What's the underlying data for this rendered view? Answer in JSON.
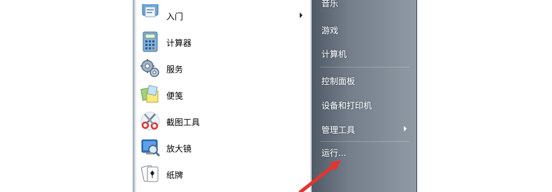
{
  "programs": [
    {
      "label": "入门"
    },
    {
      "label": "计算器"
    },
    {
      "label": "服务"
    },
    {
      "label": "便笺"
    },
    {
      "label": "截图工具"
    },
    {
      "label": "放大镜"
    },
    {
      "label": "纸牌"
    }
  ],
  "right_menu": {
    "music": "音乐",
    "games": "游戏",
    "computer": "计算机",
    "control_panel": "控制面板",
    "devices_printers": "设备和打印机",
    "admin_tools": "管理工具",
    "run": "运行..."
  },
  "colors": {
    "right_pane": "#737e8a",
    "annotation_arrow": "#e3342f"
  }
}
